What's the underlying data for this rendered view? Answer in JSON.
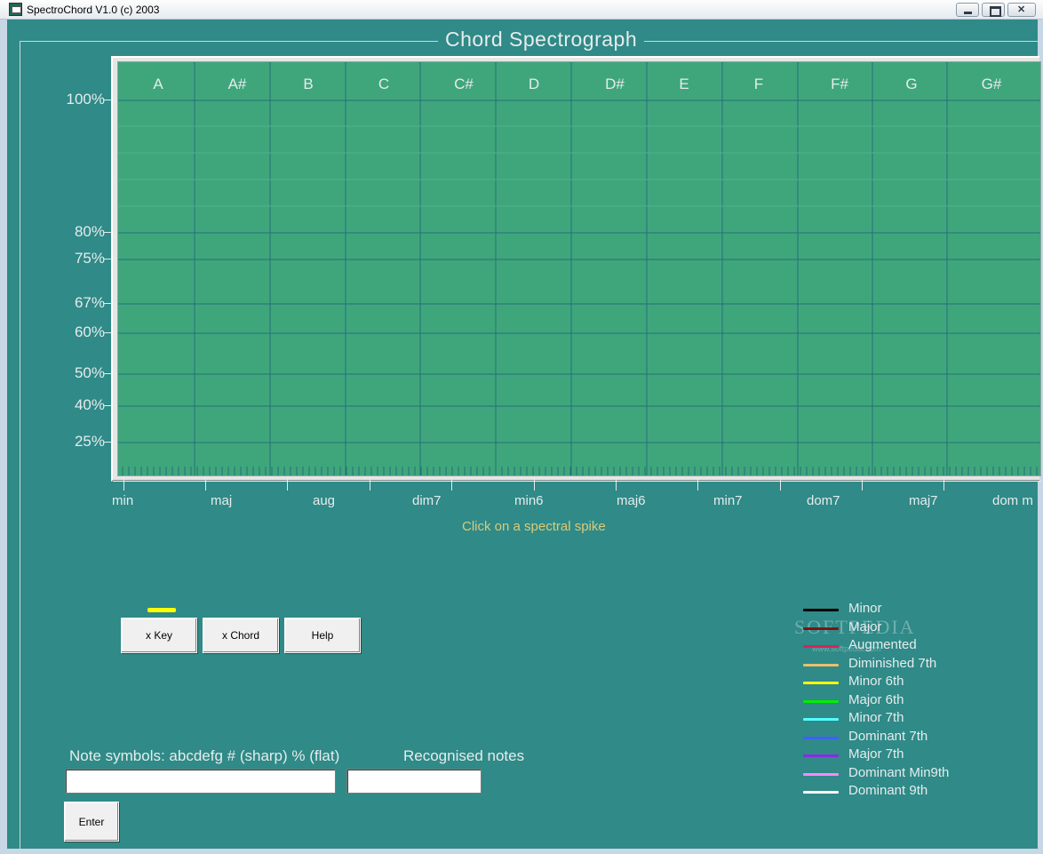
{
  "window": {
    "title": "SpectroChord V1.0 (c) 2003"
  },
  "group": {
    "title": "Chord  Spectrograph"
  },
  "graph": {
    "note_headers": [
      "A",
      "A#",
      "B",
      "C",
      "C#",
      "D",
      "D#",
      "E",
      "F",
      "F#",
      "G",
      "G#"
    ],
    "y_levels": [
      {
        "label": "100%",
        "value": 100
      },
      {
        "label": "80%",
        "value": 80
      },
      {
        "label": "75%",
        "value": 75
      },
      {
        "label": "67%",
        "value": 67
      },
      {
        "label": "60%",
        "value": 60
      },
      {
        "label": "50%",
        "value": 50
      },
      {
        "label": "40%",
        "value": 40
      },
      {
        "label": "25%",
        "value": 25
      }
    ],
    "chord_types": [
      "min",
      "maj",
      "aug",
      "dim7",
      "min6",
      "maj6",
      "min7",
      "dom7",
      "maj7",
      "dom m"
    ],
    "hint": "Click on a spectral spike",
    "background_color": "#3fa67c",
    "grid_color": "#23707a"
  },
  "buttons": {
    "xkey": "x Key",
    "xchord": "x Chord",
    "help": "Help",
    "enter": "Enter"
  },
  "legend": [
    {
      "label": "Minor",
      "color": "#000000"
    },
    {
      "label": "Major",
      "color": "#7a1515"
    },
    {
      "label": "Augmented",
      "color": "#e0205a"
    },
    {
      "label": "Diminished 7th",
      "color": "#e8c070"
    },
    {
      "label": "Minor 6th",
      "color": "#ffff00"
    },
    {
      "label": "Major 6th",
      "color": "#00ee00"
    },
    {
      "label": "Minor 7th",
      "color": "#55ffff"
    },
    {
      "label": "Dominant 7th",
      "color": "#4060ff"
    },
    {
      "label": "Major 7th",
      "color": "#8a2be2"
    },
    {
      "label": "Dominant Min9th",
      "color": "#ff88ff"
    },
    {
      "label": "Dominant 9th",
      "color": "#ffffff"
    }
  ],
  "watermark": {
    "text": "SOFTPEDIA",
    "url": "www.softpedia.com"
  },
  "input": {
    "note_symbols_label": "Note symbols: abcdefg # (sharp) % (flat)",
    "recognised_label": "Recognised notes",
    "note_value": "",
    "recognised_value": ""
  }
}
